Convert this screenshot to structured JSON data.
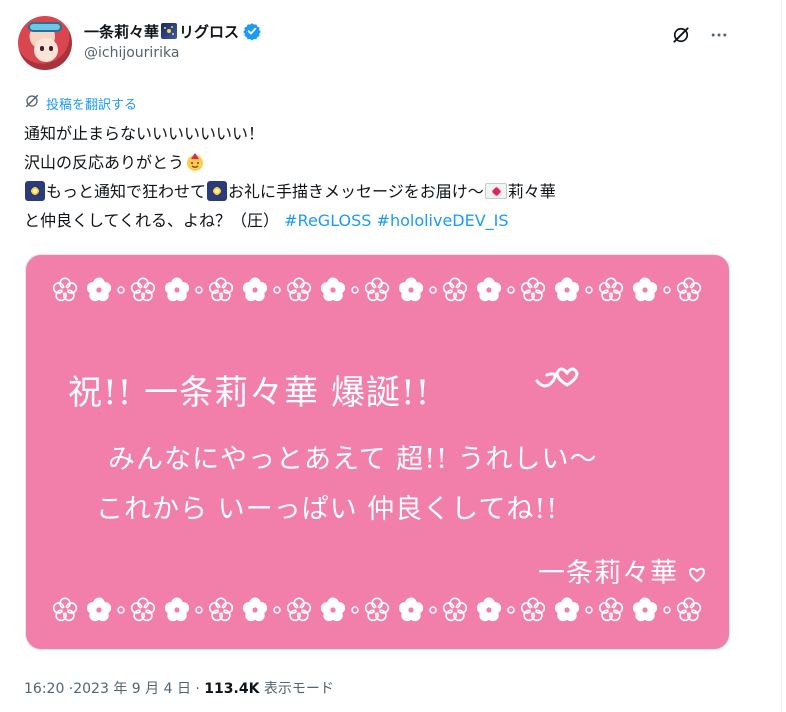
{
  "header": {
    "display_name": "一条莉々華",
    "display_name_suffix": "リグロス",
    "handle": "@ichijouririka"
  },
  "translate": {
    "label": "投稿を翻訳する"
  },
  "tweet": {
    "line1": "通知が止まらないいいいいいい！",
    "line2": "沢山の反応ありがとう",
    "line3_a": "もっと通知で狂わせて",
    "line3_b": "お礼に手描きメッセージをお届け〜",
    "line3_c": "莉々華",
    "line4": "と仲良くしてくれる、よね？（圧）",
    "hashtags": [
      "#ReGLOSS",
      "#hololiveDEV_IS"
    ]
  },
  "image": {
    "line1": "祝!! 一条莉々華 爆誕!!",
    "line2": "みんなにやっとあえて 超!! うれしい〜",
    "line3": "これから いーっぱい 仲良くしてね!!",
    "signature": "一条莉々華",
    "background": "#f17fa9"
  },
  "meta": {
    "time": "16:20 ·2023 年 9 月 4 日 · ",
    "views_count": "113.4K",
    "views_label": " 表示モード"
  },
  "colors": {
    "accent": "#1d9bf0",
    "text": "#0f1419",
    "muted": "#536471"
  },
  "icons": [
    "grok-icon",
    "more-icon",
    "verified-icon",
    "translate-icon",
    "sparkler-emoji",
    "party-face-emoji",
    "love-letter-emoji"
  ]
}
